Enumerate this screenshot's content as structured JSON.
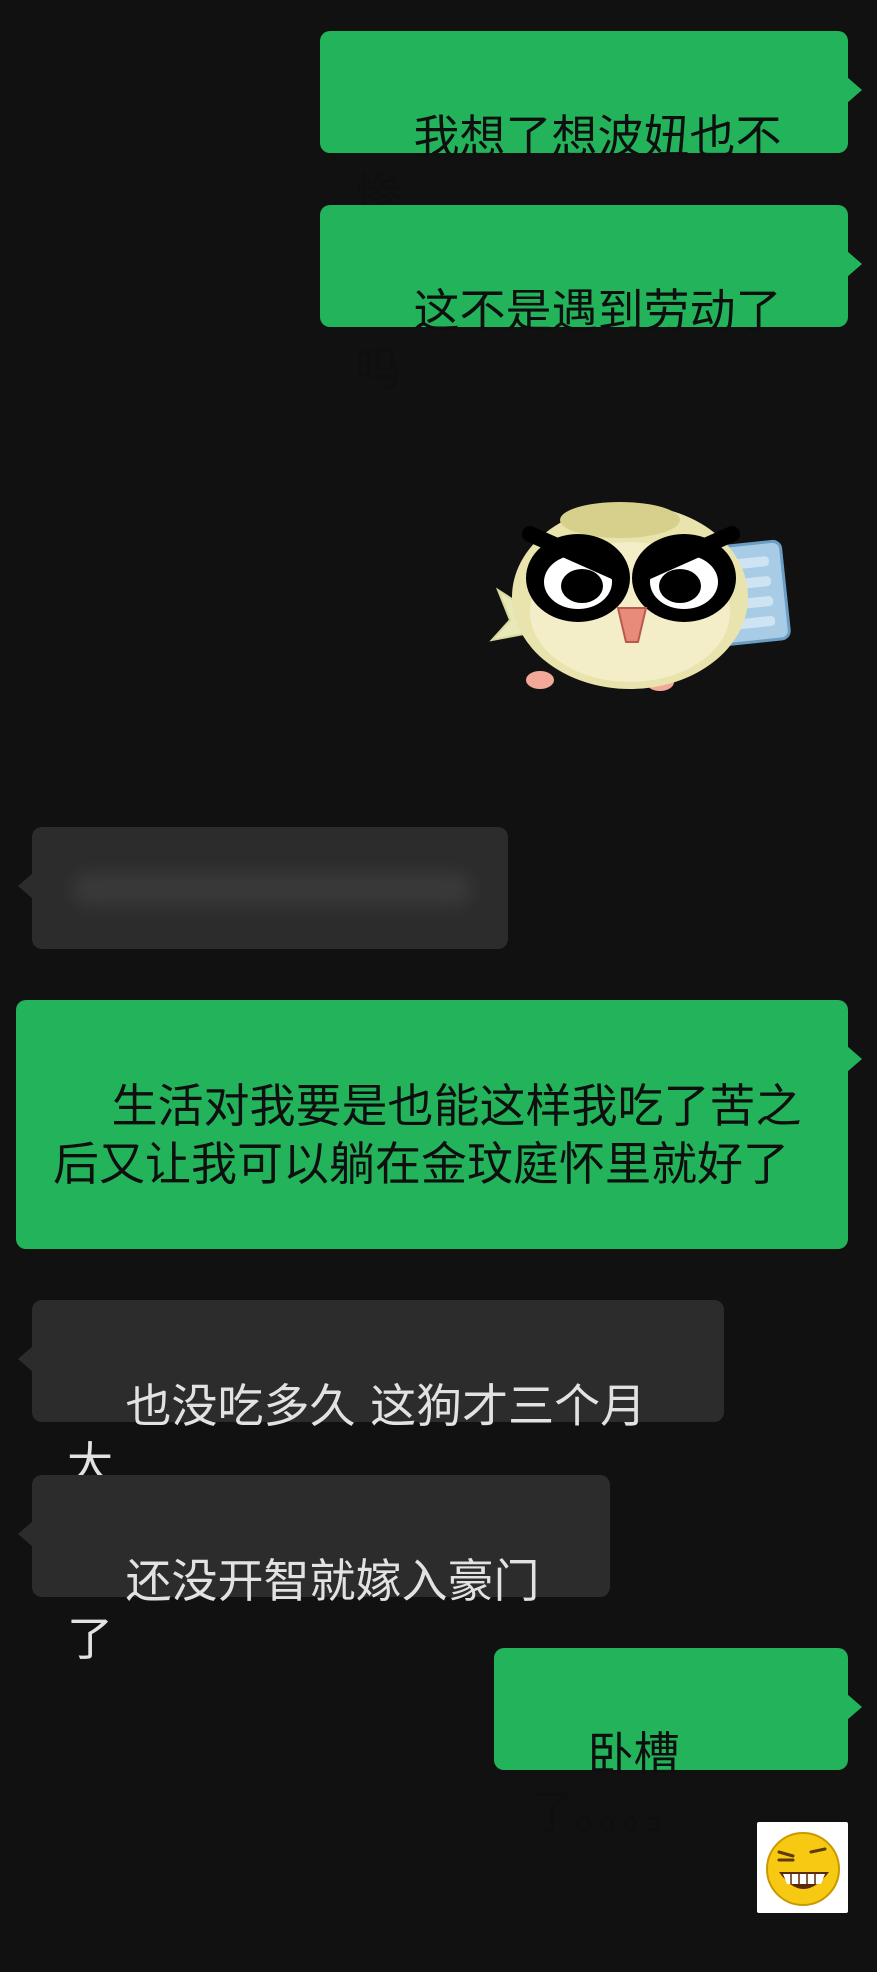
{
  "messages": [
    {
      "id": "m1",
      "side": "sent",
      "text": "我想了想波妞也不惨"
    },
    {
      "id": "m2",
      "side": "sent",
      "text": "这不是遇到劳动了吗"
    },
    {
      "id": "m3",
      "side": "sent",
      "type": "sticker",
      "sticker": "angry-yellow-bird-sticker"
    },
    {
      "id": "m4",
      "side": "recv",
      "type": "blurred"
    },
    {
      "id": "m5",
      "side": "sent",
      "text": "生活对我要是也能这样我吃了苦之后又让我可以躺在金玟庭怀里就好了"
    },
    {
      "id": "m6",
      "side": "recv",
      "text": "也没吃多久 这狗才三个月大"
    },
    {
      "id": "m7",
      "side": "recv",
      "text": "还没开智就嫁入豪门了"
    },
    {
      "id": "m8",
      "side": "sent",
      "text": "卧槽了。。。。"
    },
    {
      "id": "m9",
      "side": "sent",
      "type": "sticker",
      "sticker": "grinning-emoji-sticker"
    }
  ],
  "colors": {
    "background": "#111111",
    "sent_bubble": "#23b35a",
    "received_bubble": "#2c2c2c"
  }
}
